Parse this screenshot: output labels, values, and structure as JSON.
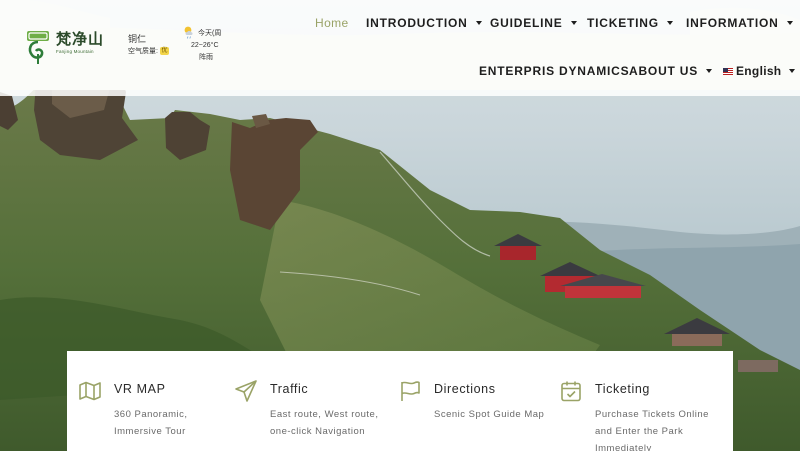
{
  "brand": {
    "logo_cn": "梵净山",
    "logo_en": "Fanjing Mountain",
    "colors": {
      "accent": "#9aa367",
      "logo_green": "#3b6a33"
    }
  },
  "weather": {
    "city": "铜仁",
    "air_quality_label": "空气质量:",
    "air_quality_badge": "优",
    "today": "今天(周",
    "temperature": "22~26°C",
    "condition": "阵雨",
    "icon": "partly-cloudy-rain-icon"
  },
  "nav": {
    "home": "Home",
    "introduction": "INTRODUCTION",
    "guideline": "GUIDELINE",
    "ticketing": "TICKETING",
    "information": "INFORMATION",
    "enterprise": "ENTERPRIS DYNAMICS",
    "about": "ABOUT US",
    "language": "English"
  },
  "features": [
    {
      "icon": "map-icon",
      "title": "VR MAP",
      "desc": [
        "360 Panoramic,",
        "Immersive Tour"
      ]
    },
    {
      "icon": "paper-plane-icon",
      "title": "Traffic",
      "desc": [
        "East route, West route,",
        "one-click Navigation"
      ]
    },
    {
      "icon": "flag-icon",
      "title": "Directions",
      "desc": [
        "Scenic Spot Guide Map"
      ]
    },
    {
      "icon": "calendar-check-icon",
      "title": "Ticketing",
      "desc": [
        "Purchase Tickets Online",
        "and Enter the Park",
        "Immediately"
      ]
    }
  ]
}
